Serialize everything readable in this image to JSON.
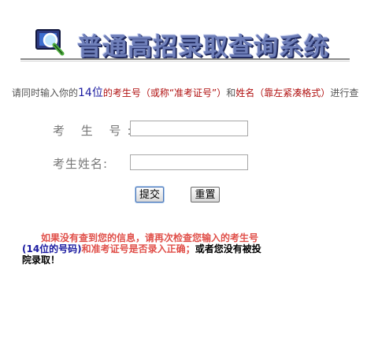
{
  "header": {
    "title": "普通高招录取查询系统",
    "icon": "magnifier-icon"
  },
  "instruction": {
    "part1": "请同时输入你的",
    "num": "14位",
    "part2": "的考生号（或称“准考证号”）",
    "part3": "和",
    "part4": "姓名（靠左紧凑格式）",
    "part5": "进行查"
  },
  "form": {
    "exam_id_label": "考 生 号:",
    "name_label": "考生姓名:",
    "exam_id_value": "",
    "name_value": ""
  },
  "buttons": {
    "submit": "提交",
    "reset": "重置"
  },
  "notice": {
    "line1": "如果没有查到您的信息，请再次检查您输入的考生号",
    "line2_blue": "(14位的号码)",
    "line2_red": "和准考证号是否录入正确；",
    "line2_black": "或者您没有被投",
    "line3": "院录取！"
  },
  "colors": {
    "title": "#6f7fb9",
    "instruction_red": "#b01010",
    "notice_red": "#e0504a",
    "notice_blue": "#1a1aa0"
  }
}
